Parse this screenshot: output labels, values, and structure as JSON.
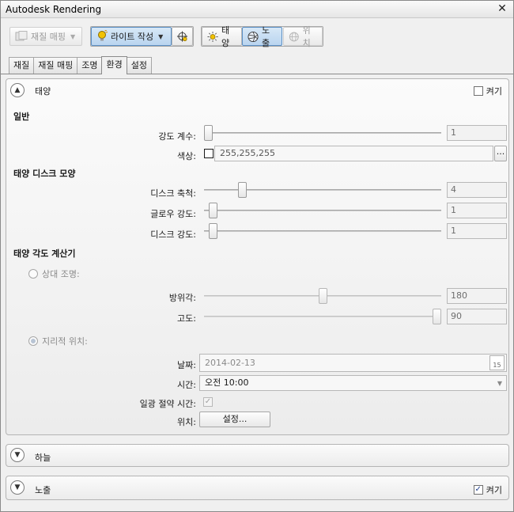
{
  "window": {
    "title": "Autodesk Rendering",
    "close_glyph": "✕"
  },
  "toolbar": {
    "material_mapping": {
      "label": "재질 매핑",
      "icon": "material-mapping-icon"
    },
    "create_light": {
      "label": "라이트 작성",
      "icon": "light-bulb-icon"
    },
    "light_locate": {
      "icon": "crosshair-icon"
    },
    "sun": {
      "label": "태양",
      "icon": "sun-icon"
    },
    "exposure": {
      "label": "노출",
      "icon": "aperture-icon"
    },
    "location": {
      "label": "위치",
      "icon": "globe-icon"
    }
  },
  "tabs": [
    {
      "label": "재질",
      "active": false
    },
    {
      "label": "재질 매핑",
      "active": false
    },
    {
      "label": "조명",
      "active": false
    },
    {
      "label": "환경",
      "active": true
    },
    {
      "label": "설정",
      "active": false
    }
  ],
  "sun_panel": {
    "title": "태양",
    "on_label": "켜기",
    "on_checked": false,
    "general": {
      "heading": "일반",
      "intensity_label": "강도 계수:",
      "intensity_value": "1",
      "intensity_fraction": 0.0,
      "color_label": "색상:",
      "color_value": "255,255,255",
      "color_swatch": "#ffffff",
      "browse_label": "..."
    },
    "disc": {
      "heading": "태양 디스크 모양",
      "scale_label": "디스크 축척:",
      "scale_value": "4",
      "scale_fraction": 0.15,
      "glow_label": "글로우 강도:",
      "glow_value": "1",
      "glow_fraction": 0.02,
      "brightness_label": "디스크 강도:",
      "brightness_value": "1",
      "brightness_fraction": 0.02
    },
    "calculator": {
      "heading": "태양 각도 계산기",
      "relative_label": "상대 조명:",
      "relative_selected": false,
      "azimuth_label": "방위각:",
      "azimuth_value": "180",
      "azimuth_fraction": 0.5,
      "altitude_label": "고도:",
      "altitude_value": "90",
      "altitude_fraction": 1.0,
      "geo_label": "지리적 위치:",
      "geo_selected": true,
      "date_label": "날짜:",
      "date_value": "2014-02-13",
      "calendar_day": "15",
      "time_label": "시간:",
      "time_value": "오전 10:00",
      "dst_label": "일광 절약 시간:",
      "dst_checked": true,
      "location_label": "위치:",
      "location_button": "설정..."
    }
  },
  "sky_panel": {
    "title": "하늘"
  },
  "exposure_panel": {
    "title": "노출",
    "on_label": "켜기",
    "on_checked": true
  },
  "colors": {
    "accent": "#5b8fc4",
    "active_tab_bg": "#f0f0f0",
    "sun_yellow": "#f2c200",
    "check_blue": "#1f3f8f"
  }
}
